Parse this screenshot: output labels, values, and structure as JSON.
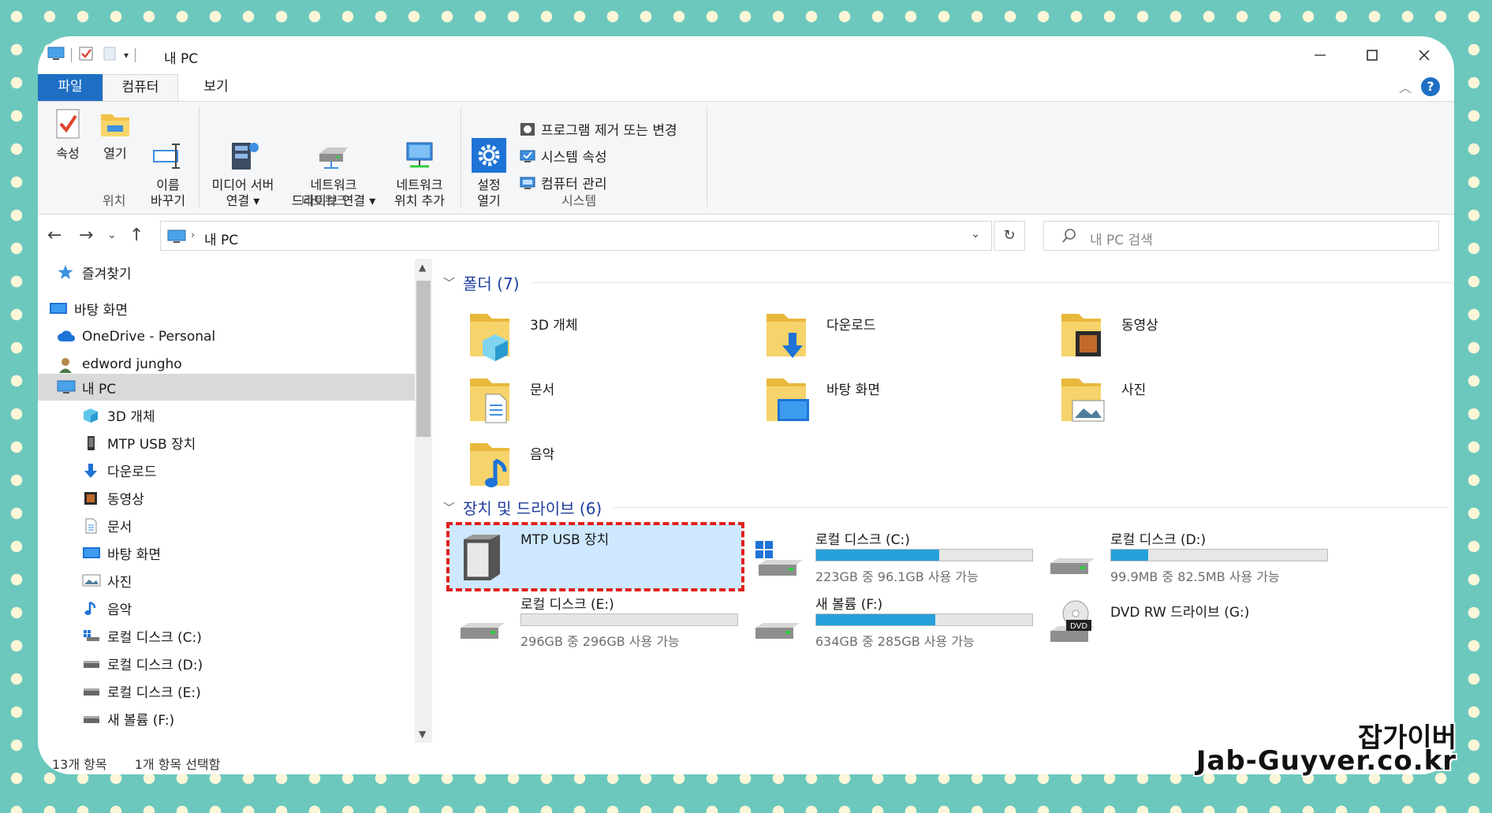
{
  "window": {
    "title": "내 PC",
    "controls": [
      "minimize",
      "maximize",
      "close"
    ]
  },
  "ribbon": {
    "tabs": [
      {
        "label": "파일",
        "active": false,
        "style": "file"
      },
      {
        "label": "컴퓨터",
        "active": true
      },
      {
        "label": "보기",
        "active": false
      }
    ],
    "groups": [
      {
        "label": "위치",
        "buttons": [
          {
            "label": "속성",
            "icon": "checkmark-properties-icon"
          },
          {
            "label": "열기",
            "icon": "folder-open-icon"
          },
          {
            "label": "이름\n바꾸기",
            "icon": "rename-icon"
          }
        ]
      },
      {
        "label": "네트워크",
        "buttons": [
          {
            "label": "미디어 서버\n연결 ▾",
            "icon": "media-server-icon"
          },
          {
            "label": "네트워크\n드라이브 연결 ▾",
            "icon": "network-drive-icon"
          },
          {
            "label": "네트워크\n위치 추가",
            "icon": "network-location-icon"
          }
        ]
      },
      {
        "label": "시스템",
        "buttons": [
          {
            "label": "설정\n열기",
            "icon": "settings-gear-icon"
          }
        ],
        "small_items": [
          {
            "label": "프로그램 제거 또는 변경",
            "icon": "uninstall-icon"
          },
          {
            "label": "시스템 속성",
            "icon": "system-properties-icon"
          },
          {
            "label": "컴퓨터 관리",
            "icon": "computer-management-icon"
          }
        ]
      }
    ]
  },
  "address": {
    "path": "내 PC",
    "search_placeholder": "내 PC 검색"
  },
  "nav_pane": {
    "items": [
      {
        "label": "즐겨찾기",
        "icon": "star-icon",
        "indent": 1
      },
      {
        "label": "바탕 화면",
        "icon": "desktop-icon",
        "indent": 0
      },
      {
        "label": "OneDrive - Personal",
        "icon": "cloud-icon",
        "indent": 1
      },
      {
        "label": "edword jungho",
        "icon": "user-icon",
        "indent": 1
      },
      {
        "label": "내 PC",
        "icon": "pc-icon",
        "indent": 1,
        "selected": true
      },
      {
        "label": "3D 개체",
        "icon": "cube-3d-icon",
        "indent": 2
      },
      {
        "label": "MTP USB 장치",
        "icon": "phone-icon",
        "indent": 2
      },
      {
        "label": "다운로드",
        "icon": "download-arrow-icon",
        "indent": 2
      },
      {
        "label": "동영상",
        "icon": "video-icon",
        "indent": 2
      },
      {
        "label": "문서",
        "icon": "document-icon",
        "indent": 2
      },
      {
        "label": "바탕 화면",
        "icon": "desktop-icon",
        "indent": 2
      },
      {
        "label": "사진",
        "icon": "picture-icon",
        "indent": 2
      },
      {
        "label": "음악",
        "icon": "music-note-icon",
        "indent": 2
      },
      {
        "label": "로컬 디스크 (C:)",
        "icon": "windows-drive-icon",
        "indent": 2
      },
      {
        "label": "로컬 디스크 (D:)",
        "icon": "drive-icon",
        "indent": 2
      },
      {
        "label": "로컬 디스크 (E:)",
        "icon": "drive-icon",
        "indent": 2
      },
      {
        "label": "새 볼륨 (F:)",
        "icon": "drive-icon",
        "indent": 2
      }
    ]
  },
  "content": {
    "folders_header": "폴더 (7)",
    "folders": [
      {
        "label": "3D 개체",
        "icon": "folder-3d-icon"
      },
      {
        "label": "다운로드",
        "icon": "folder-download-icon"
      },
      {
        "label": "동영상",
        "icon": "folder-video-icon"
      },
      {
        "label": "문서",
        "icon": "folder-document-icon"
      },
      {
        "label": "바탕 화면",
        "icon": "folder-desktop-icon"
      },
      {
        "label": "사진",
        "icon": "folder-picture-icon"
      },
      {
        "label": "음악",
        "icon": "folder-music-icon"
      }
    ],
    "devices_header": "장치 및 드라이브 (6)",
    "devices": [
      {
        "label": "MTP USB 장치",
        "icon": "mtp-device-icon",
        "selected": true
      },
      {
        "label": "로컬 디스크 (C:)",
        "icon": "windows-drive-icon",
        "used_fraction": 0.57,
        "info": "223GB 중 96.1GB 사용 가능"
      },
      {
        "label": "로컬 디스크 (D:)",
        "icon": "drive-icon",
        "used_fraction": 0.17,
        "info": "99.9MB 중 82.5MB 사용 가능"
      },
      {
        "label": "로컬 디스크 (E:)",
        "icon": "drive-icon",
        "used_fraction": 0.0,
        "info": "296GB 중 296GB 사용 가능"
      },
      {
        "label": "새 볼륨 (F:)",
        "icon": "drive-icon",
        "used_fraction": 0.55,
        "info": "634GB 중 285GB 사용 가능"
      },
      {
        "label": "DVD RW 드라이브 (G:)",
        "icon": "dvd-drive-icon"
      }
    ]
  },
  "status_bar": {
    "count": "13개 항목",
    "selection": "1개 항목 선택함"
  },
  "watermark": {
    "line1": "잡가이버",
    "line2": "Jab-Guyver.co.kr"
  },
  "colors": {
    "accent": "#1e6fc4",
    "selection": "#cde8ff",
    "drive_bar": "#26a0da",
    "highlight_dash": "#e0201e",
    "section_header": "#1e3d9c"
  }
}
